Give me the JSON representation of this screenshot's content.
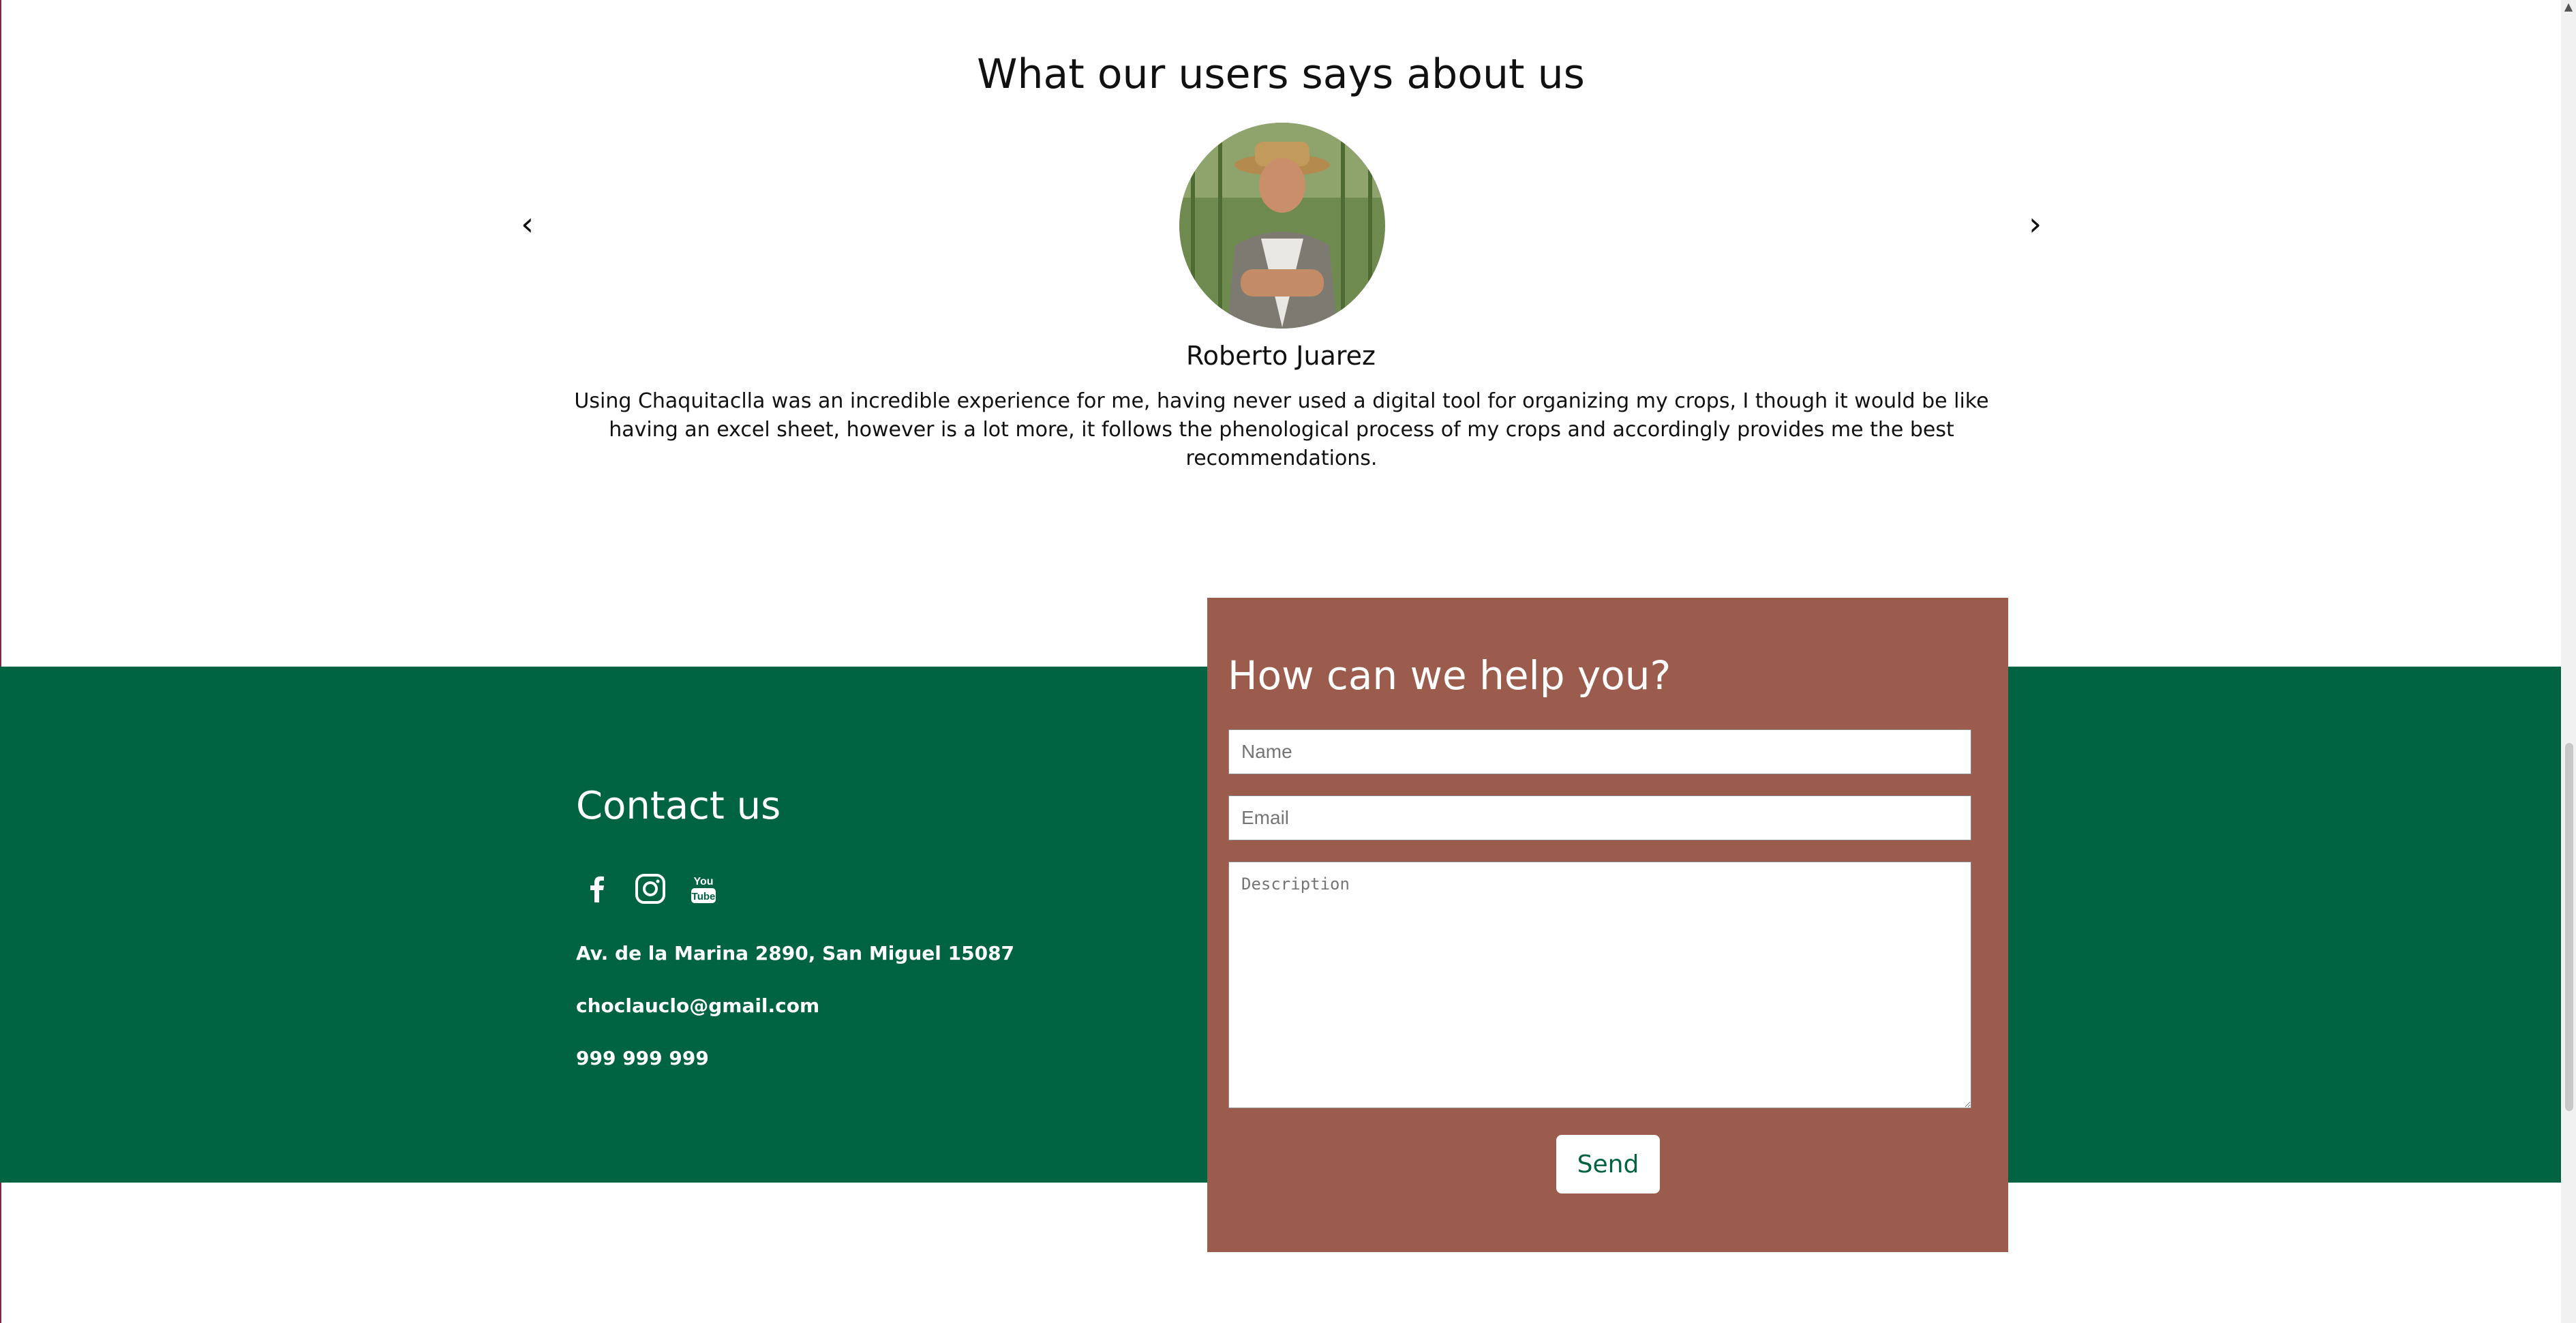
{
  "testimonials": {
    "title": "What our users says about us",
    "prev": "‹",
    "next": "›",
    "current": {
      "name": "Roberto Juarez",
      "text": "Using Chaquitaclla was an incredible experience for me, having never used a digital tool for organizing my crops, I though it would be like having an excel sheet, however is a lot more, it follows the phenological process  of my crops and accordingly provides me the best recommendations."
    }
  },
  "contact": {
    "title": "Contact us",
    "social_icons": [
      "facebook-icon",
      "instagram-icon",
      "youtube-icon"
    ],
    "address": "Av. de la Marina 2890, San Miguel 15087",
    "email": "choclauclo@gmail.com",
    "phone": "999 999 999"
  },
  "form": {
    "title": "How can we help you?",
    "name_placeholder": "Name",
    "email_placeholder": "Email",
    "description_placeholder": "Description",
    "send_label": "Send"
  },
  "colors": {
    "green": "#006341",
    "form_panel": "#9b5c4d"
  }
}
